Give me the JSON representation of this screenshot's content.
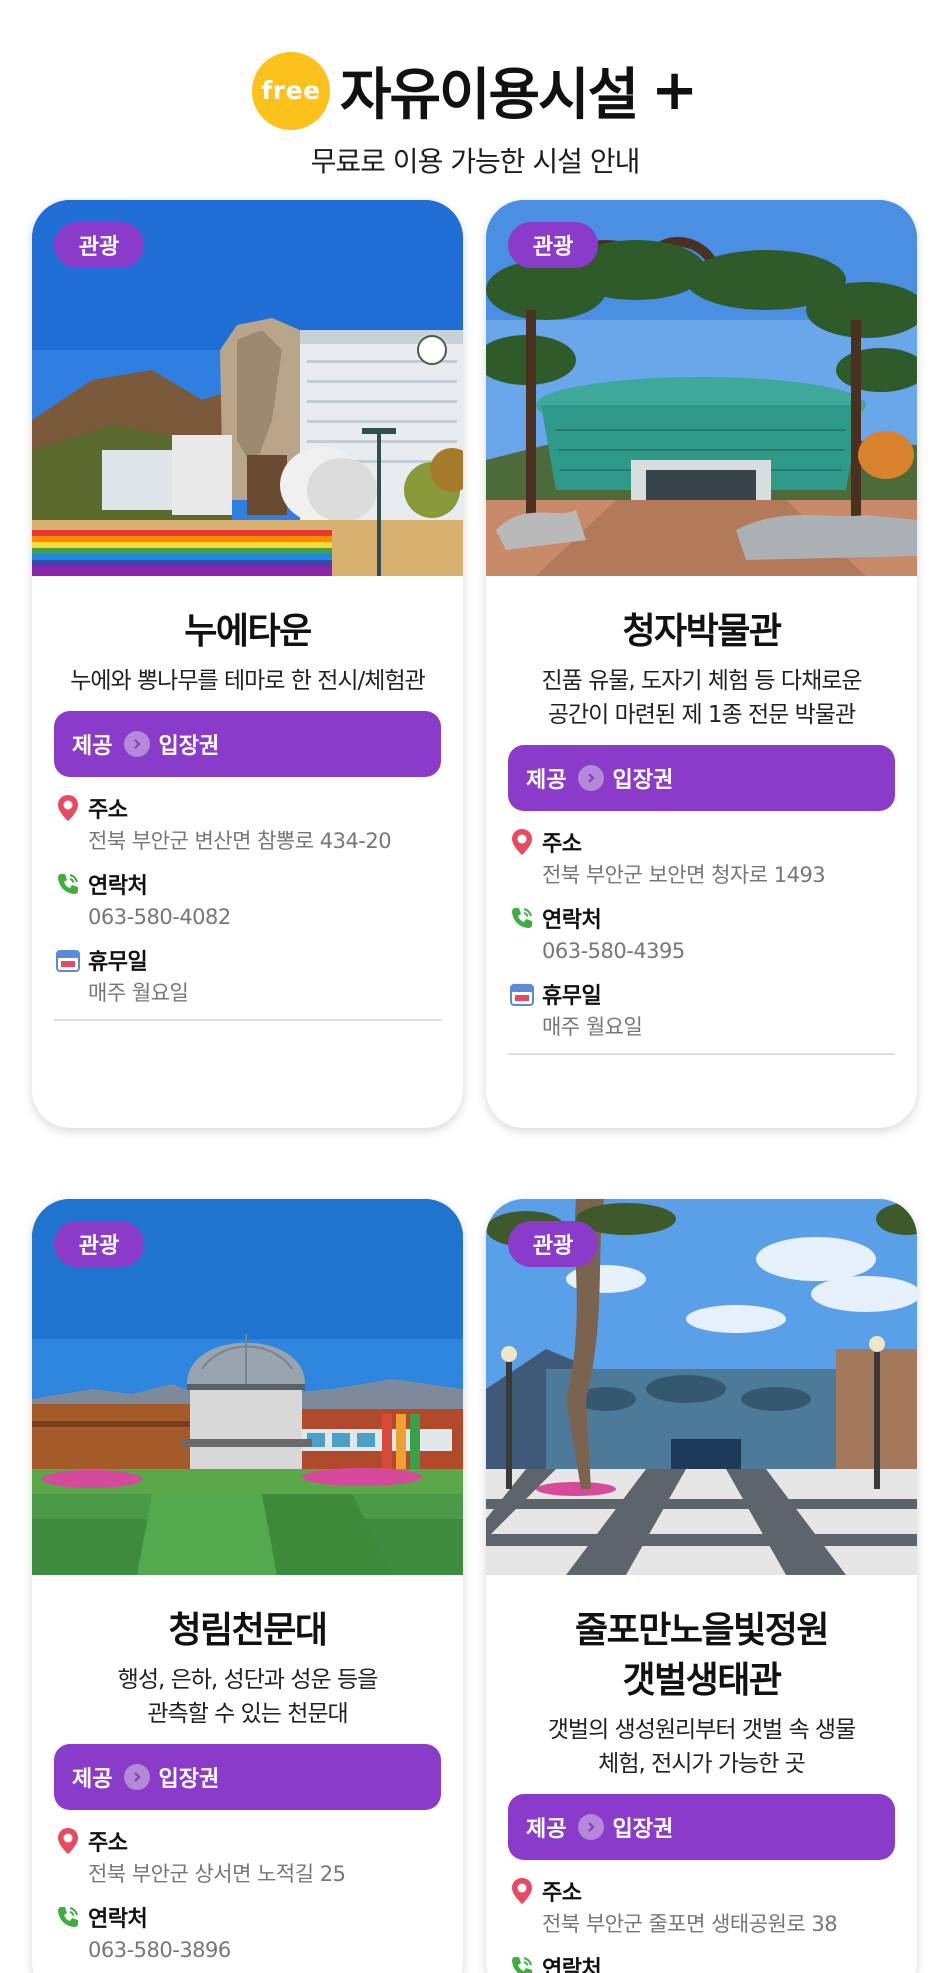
{
  "header": {
    "badge": "free",
    "title": "자유이용시설",
    "plus": "+",
    "subtitle": "무료로 이용 가능한 시설 안내"
  },
  "labels": {
    "address": "주소",
    "phone": "연락처",
    "closed": "휴무일"
  },
  "colors": {
    "purple": "#8a3bc9",
    "yellow": "#fcc21b",
    "pin": "#e84a5f",
    "phone": "#3fae3f"
  },
  "cards": [
    {
      "category": "관광",
      "name": "누에타운",
      "desc": [
        "누에와 뽕나무를 테마로 한 전시/체험관"
      ],
      "offer_label": "제공",
      "offer_value": "입장권",
      "address": "전북 부안군 변산면 참뽕로 434-20",
      "phone": "063-580-4082",
      "closed": "매주 월요일"
    },
    {
      "category": "관광",
      "name": "청자박물관",
      "desc": [
        "진품 유물, 도자기 체험 등 다채로운",
        "공간이 마련된 제 1종 전문 박물관"
      ],
      "offer_label": "제공",
      "offer_value": "입장권",
      "address": "전북 부안군 보안면 청자로 1493",
      "phone": "063-580-4395",
      "closed": "매주 월요일"
    },
    {
      "category": "관광",
      "name": "청림천문대",
      "desc": [
        "행성, 은하, 성단과 성운 등을",
        "관측할 수 있는 천문대"
      ],
      "offer_label": "제공",
      "offer_value": "입장권",
      "address": "전북 부안군 상서면 노적길 25",
      "phone": "063-580-3896"
    },
    {
      "category": "관광",
      "name": [
        "줄포만노을빛정원",
        "갯벌생태관"
      ],
      "desc": [
        "갯벌의 생성원리부터 갯벌 속 생물",
        "체험, 전시가 가능한 곳"
      ],
      "offer_label": "제공",
      "offer_value": "입장권",
      "address": "전북 부안군 줄포면 생태공원로 38",
      "phone_partial": "연락처"
    }
  ]
}
